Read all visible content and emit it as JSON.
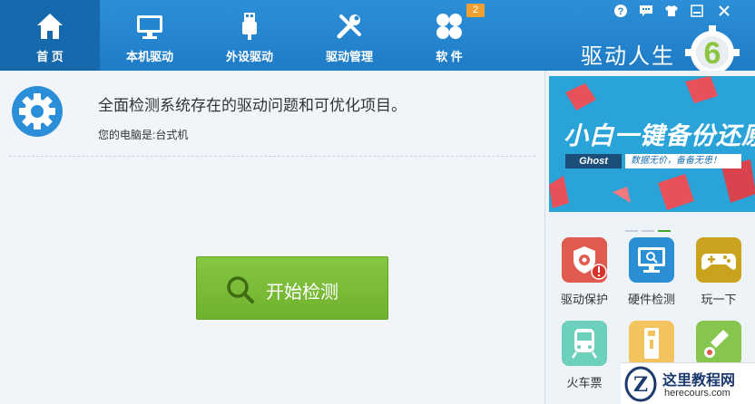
{
  "tabs": [
    {
      "label": "首 页",
      "icon": "home-icon",
      "active": true
    },
    {
      "label": "本机驱动",
      "icon": "monitor-icon",
      "active": false
    },
    {
      "label": "外设驱动",
      "icon": "usb-icon",
      "active": false
    },
    {
      "label": "驱动管理",
      "icon": "tools-icon",
      "active": false
    },
    {
      "label": "软 件",
      "icon": "apps-icon",
      "active": false
    }
  ],
  "software_badge": "2",
  "brand": {
    "name": "驱动人生",
    "version_mark": "6"
  },
  "window_controls": [
    "help-icon",
    "feedback-icon",
    "skin-icon",
    "minimize-icon",
    "close-icon"
  ],
  "main": {
    "headline": "全面检测系统存在的驱动问题和可优化项目。",
    "device_line": "您的电脑是:台式机",
    "start_button": "开始检测"
  },
  "banner": {
    "title": "小白一键备份还原",
    "tag": "Ghost",
    "subtitle": "数据无价，备备无患！",
    "slide_count": 3,
    "active_slide": 3
  },
  "apps": [
    {
      "label": "驱动保护",
      "icon": "shield-gear-icon",
      "color": "#e15a4f"
    },
    {
      "label": "硬件检测",
      "icon": "monitor-search-icon",
      "color": "#2a8fd4"
    },
    {
      "label": "玩一下",
      "icon": "gamepad-icon",
      "color": "#c9a31d"
    },
    {
      "label": "火车票",
      "icon": "train-icon",
      "color": "#6dd0bd"
    },
    {
      "label": "",
      "icon": "usb-drive-icon",
      "color": "#f3c35d"
    },
    {
      "label": "",
      "icon": "thermometer-icon",
      "color": "#86c64e"
    }
  ],
  "watermark": {
    "title": "这里教程网",
    "url": "herecours.com"
  },
  "colors": {
    "topbar": "#2387d0",
    "start_button": "#7bbd38",
    "banner": "#2aa3d9"
  }
}
